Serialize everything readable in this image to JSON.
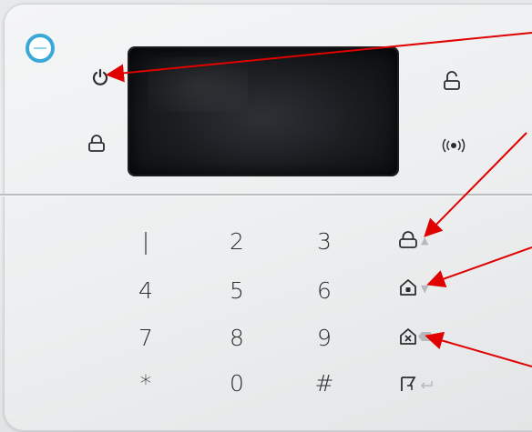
{
  "keypad": {
    "row1": [
      "|",
      "2",
      "3"
    ],
    "row2": [
      "4",
      "5",
      "6"
    ],
    "row3": [
      "7",
      "8",
      "9"
    ],
    "row4": [
      "*",
      "0",
      "#"
    ]
  },
  "icons": {
    "power": "power-icon",
    "unlock": "unlock-icon",
    "lock_top": "lock-icon",
    "alarm": "alarm-siren-icon",
    "arm": "lock-icon",
    "home_arm": "home-arm-icon",
    "home_cancel": "home-cancel-icon",
    "function": "function-icon",
    "enter": "enter-icon",
    "up": "up-arrow-icon",
    "down": "down-arrow-icon",
    "backspace": "backspace-icon"
  },
  "colors": {
    "accent": "#3aa8d6",
    "annotation": "#e00000",
    "screen": "#17191c"
  }
}
